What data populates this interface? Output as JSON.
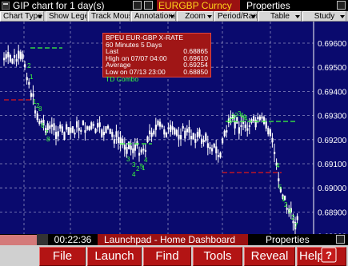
{
  "titlebar": {
    "chart_title": "GIP chart for 1 day(s)",
    "symbol": "EURGBP Curncy",
    "properties": "Properties"
  },
  "toolbar": {
    "buttons": [
      "Chart Type",
      "Show Legend",
      "Track Mouse",
      "Annotations",
      "Zoom",
      "Period/Range",
      "Table",
      "Study"
    ]
  },
  "infobox": {
    "line1": "BPEU   EUR-GBP X-RATE",
    "line2": "60 Minutes  5 Days",
    "last_label": "Last",
    "last_value": "0.68865",
    "high_label": "High on   07/07 04:00",
    "high_value": "0.69610",
    "avg_label": "Average",
    "avg_value": "0.69254",
    "low_label": "Low on  07/13 23:00",
    "low_value": "0.68850",
    "combo": "TD Combo"
  },
  "colors": {
    "chart_bg": "#0a0a6e",
    "candles": "#ffffff",
    "td_green": "#3cff3c",
    "td_red": "#e01818",
    "grid": "#8d8dc0",
    "info_bg": "#a01616",
    "symbol_bg": "#9b1111",
    "symbol_fg": "#ffd21a",
    "launch_btn": "#b31414"
  },
  "chart_data": {
    "type": "candlestick",
    "y_axis": {
      "ticks": [
        "0.69600",
        "0.69500",
        "0.69400",
        "0.69300",
        "0.69200",
        "0.69100",
        "0.69000",
        "0.68900",
        "0.68800"
      ],
      "ylim": [
        0.6878,
        0.6969
      ]
    },
    "grid": true,
    "td_numbers_green": [
      "2",
      "1",
      "6",
      "7",
      "8",
      "4",
      "5",
      "3",
      "3",
      "2",
      "1",
      "4",
      "5",
      "3",
      "2",
      "3",
      "4",
      "4",
      "4",
      "5",
      "1",
      "2",
      "3",
      "2",
      "7"
    ],
    "td_numbers_red": [
      "1",
      "2",
      "8",
      "4"
    ]
  },
  "launchpad": {
    "time": "00:22:36",
    "title": "Launchpad - Home Dashboard",
    "properties": "Properties",
    "menu": [
      "File",
      "Launch",
      "Find",
      "Tools",
      "Reveal",
      "Help"
    ]
  }
}
